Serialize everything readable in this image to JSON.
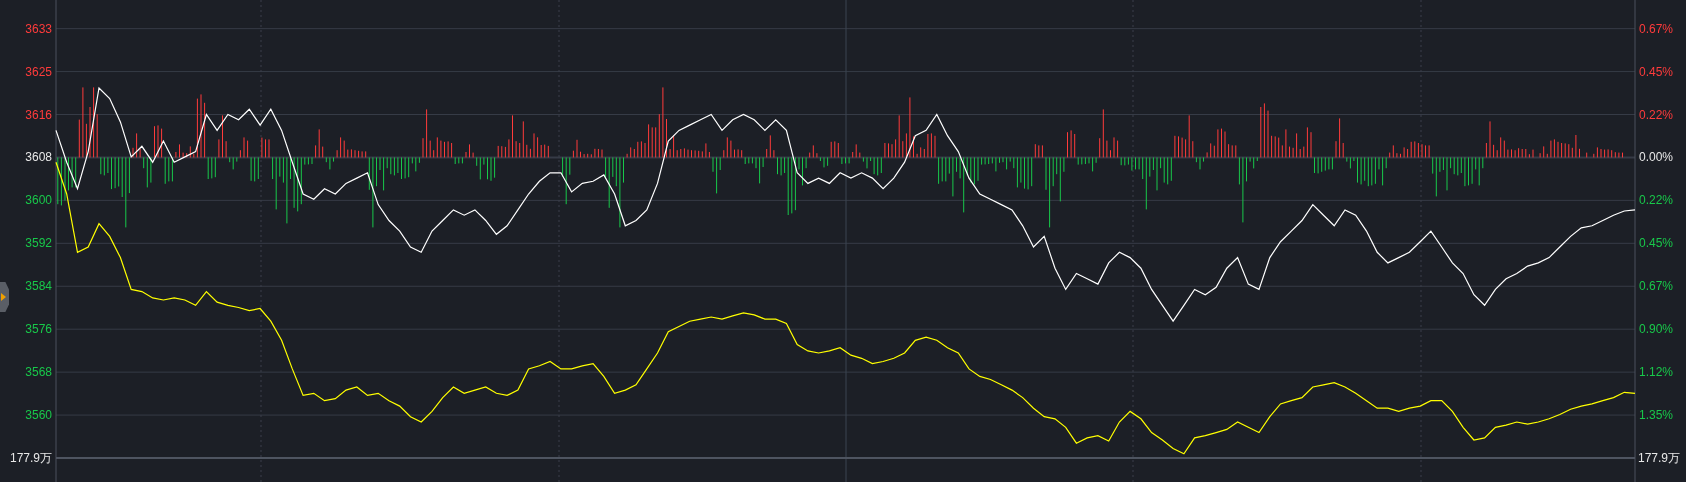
{
  "chart_data": {
    "type": "line",
    "grid": true,
    "ylim": [
      3551.6,
      3638.0
    ],
    "yticks": [
      {
        "value": 3632.6,
        "label": "3633"
      },
      {
        "value": 3624.5,
        "label": "3625"
      },
      {
        "value": 3616.4,
        "label": "3616"
      },
      {
        "value": 3608.3,
        "label": "3608"
      },
      {
        "value": 3600.2,
        "label": "3600"
      },
      {
        "value": 3592.1,
        "label": "3592"
      },
      {
        "value": 3584.0,
        "label": "3584"
      },
      {
        "value": 3575.9,
        "label": "3576"
      },
      {
        "value": 3567.8,
        "label": "3568"
      },
      {
        "value": 3559.7,
        "label": "3560"
      }
    ],
    "series": [
      {
        "color": "#ffffff",
        "values": [
          3613.4,
          3607.4,
          3602.4,
          3609.4,
          3621.4,
          3619.4,
          3615.0,
          3608.4,
          3610.4,
          3607.4,
          3611.4,
          3607.4,
          3608.4,
          3609.4,
          3616.4,
          3613.4,
          3616.4,
          3615.4,
          3617.4,
          3614.4,
          3617.4,
          3613.4,
          3607.4,
          3601.4,
          3600.4,
          3602.4,
          3601.4,
          3603.4,
          3604.4,
          3605.4,
          3599.4,
          3596.4,
          3594.4,
          3591.4,
          3590.4,
          3594.4,
          3596.4,
          3598.4,
          3597.4,
          3598.4,
          3596.4,
          3593.8,
          3595.4,
          3598.4,
          3601.4,
          3603.8,
          3605.4,
          3605.4,
          3601.8,
          3603.4,
          3603.8,
          3605.0,
          3601.4,
          3595.4,
          3596.4,
          3598.4,
          3603.4,
          3611.4,
          3613.4,
          3614.4,
          3615.4,
          3616.4,
          3613.4,
          3615.4,
          3616.4,
          3615.4,
          3613.4,
          3615.4,
          3613.4,
          3605.4,
          3603.4,
          3604.4,
          3603.4,
          3605.4,
          3604.4,
          3605.4,
          3604.4,
          3602.4,
          3604.4,
          3607.4,
          3612.4,
          3613.4,
          3616.4,
          3612.4,
          3609.4,
          3604.4,
          3601.4,
          3600.4,
          3599.4,
          3598.4,
          3595.4,
          3591.4,
          3593.4,
          3587.4,
          3583.4,
          3586.4,
          3585.4,
          3584.4,
          3588.4,
          3590.4,
          3589.4,
          3587.4,
          3583.4,
          3580.4,
          3577.4,
          3580.4,
          3583.4,
          3582.4,
          3583.8,
          3587.4,
          3589.4,
          3584.4,
          3583.4,
          3589.4,
          3592.4,
          3594.4,
          3596.4,
          3599.4,
          3597.4,
          3595.4,
          3598.4,
          3597.4,
          3594.4,
          3590.4,
          3588.4,
          3589.4,
          3590.4,
          3592.4,
          3594.4,
          3591.4,
          3588.4,
          3586.4,
          3582.4,
          3580.4,
          3583.4,
          3585.4,
          3586.4,
          3587.8,
          3588.4,
          3589.4,
          3591.4,
          3593.4,
          3595.0,
          3595.4,
          3596.4,
          3597.4,
          3598.2,
          3598.4
        ]
      },
      {
        "color": "#ffff00",
        "values": [
          3607.4,
          3601.4,
          3590.4,
          3591.4,
          3595.8,
          3593.4,
          3589.4,
          3583.4,
          3583.0,
          3581.8,
          3581.4,
          3581.8,
          3581.4,
          3580.4,
          3583.0,
          3581.0,
          3580.4,
          3580.0,
          3579.4,
          3579.8,
          3577.4,
          3573.8,
          3568.4,
          3563.4,
          3563.8,
          3562.4,
          3562.8,
          3564.4,
          3565.0,
          3563.4,
          3563.8,
          3562.4,
          3561.4,
          3559.4,
          3558.4,
          3560.4,
          3563.0,
          3565.0,
          3563.8,
          3564.4,
          3565.0,
          3563.8,
          3563.4,
          3564.4,
          3568.4,
          3569.0,
          3569.8,
          3568.4,
          3568.4,
          3569.0,
          3569.4,
          3567.0,
          3563.8,
          3564.4,
          3565.4,
          3568.4,
          3571.4,
          3575.4,
          3576.4,
          3577.4,
          3577.8,
          3578.2,
          3577.8,
          3578.4,
          3579.0,
          3578.6,
          3577.8,
          3577.8,
          3577.0,
          3573.0,
          3571.8,
          3571.4,
          3571.8,
          3572.4,
          3571.0,
          3570.4,
          3569.4,
          3569.8,
          3570.4,
          3571.4,
          3573.8,
          3574.4,
          3573.8,
          3572.4,
          3571.4,
          3568.4,
          3567.0,
          3566.4,
          3565.4,
          3564.4,
          3563.0,
          3561.0,
          3559.4,
          3559.0,
          3557.4,
          3554.4,
          3555.4,
          3555.8,
          3554.8,
          3558.4,
          3560.4,
          3559.0,
          3556.4,
          3555.0,
          3553.4,
          3552.4,
          3555.4,
          3555.8,
          3556.4,
          3557.0,
          3558.4,
          3557.4,
          3556.4,
          3559.4,
          3561.8,
          3562.4,
          3563.0,
          3565.0,
          3565.4,
          3565.8,
          3565.0,
          3563.8,
          3562.4,
          3561.0,
          3561.0,
          3560.4,
          3561.0,
          3561.4,
          3562.4,
          3562.4,
          3560.4,
          3557.4,
          3555.0,
          3555.4,
          3557.4,
          3557.8,
          3558.4,
          3558.0,
          3558.4,
          3559.0,
          3559.8,
          3560.8,
          3561.4,
          3561.8,
          3562.4,
          3563.0,
          3564.0,
          3563.8
        ]
      }
    ]
  },
  "right_axis": [
    {
      "label": "0.67%",
      "color": "#ff3b3b"
    },
    {
      "label": "0.45%",
      "color": "#ff3b3b"
    },
    {
      "label": "0.22%",
      "color": "#ff3b3b"
    },
    {
      "label": "0.00%",
      "color": "#e8e8e8"
    },
    {
      "label": "0.22%",
      "color": "#18c84a"
    },
    {
      "label": "0.45%",
      "color": "#18c84a"
    },
    {
      "label": "0.67%",
      "color": "#18c84a"
    },
    {
      "label": "0.90%",
      "color": "#18c84a"
    },
    {
      "label": "1.12%",
      "color": "#18c84a"
    },
    {
      "label": "1.35%",
      "color": "#18c84a"
    }
  ],
  "volume_label_left": "177.9万",
  "volume_label_right": "177.9万"
}
